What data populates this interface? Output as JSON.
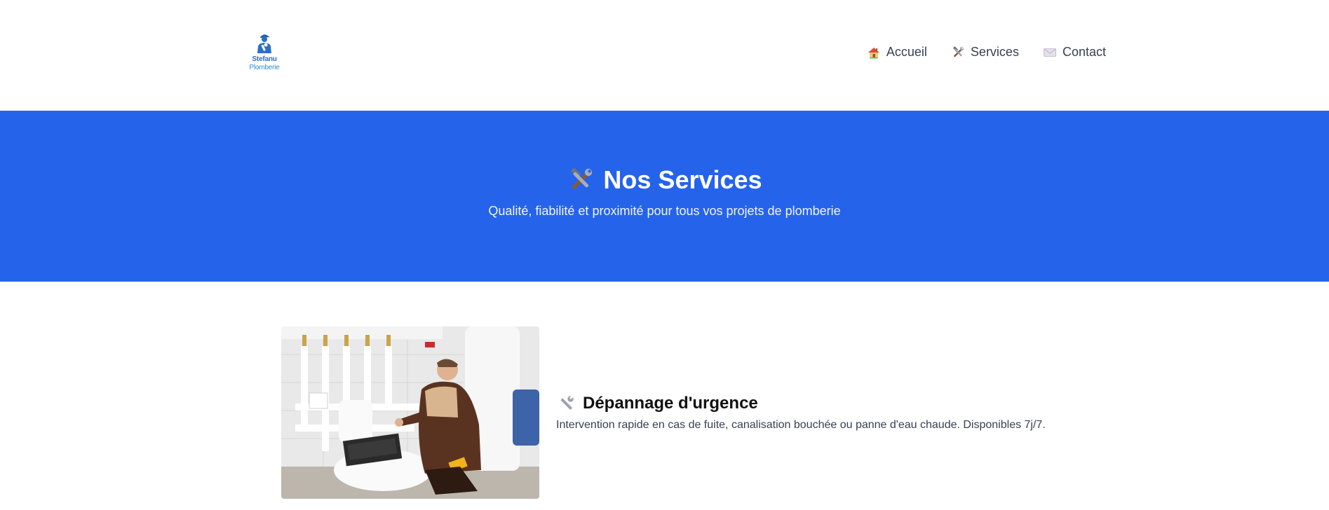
{
  "logo": {
    "line1": "Stefanu",
    "line2": "Plomberie",
    "icon": "plumber-logo-icon"
  },
  "nav": {
    "items": [
      {
        "label": "Accueil",
        "icon": "house-icon"
      },
      {
        "label": "Services",
        "icon": "hammer-wrench-icon"
      },
      {
        "label": "Contact",
        "icon": "envelope-icon"
      }
    ]
  },
  "hero": {
    "title": "Nos Services",
    "icon": "hammer-wrench-icon",
    "subtitle": "Qualité, fiabilité et proximité pour tous vos projets de plomberie"
  },
  "services": [
    {
      "title": "Dépannage d'urgence",
      "icon": "wrench-icon",
      "description": "Intervention rapide en cas de fuite, canalisation bouchée ou panne d'eau chaude. Disponibles 7j/7."
    }
  ],
  "colors": {
    "brand_blue": "#2563eb",
    "logo_blue": "#2b6fc4",
    "text_dark": "#111111",
    "text_body": "#374151"
  }
}
